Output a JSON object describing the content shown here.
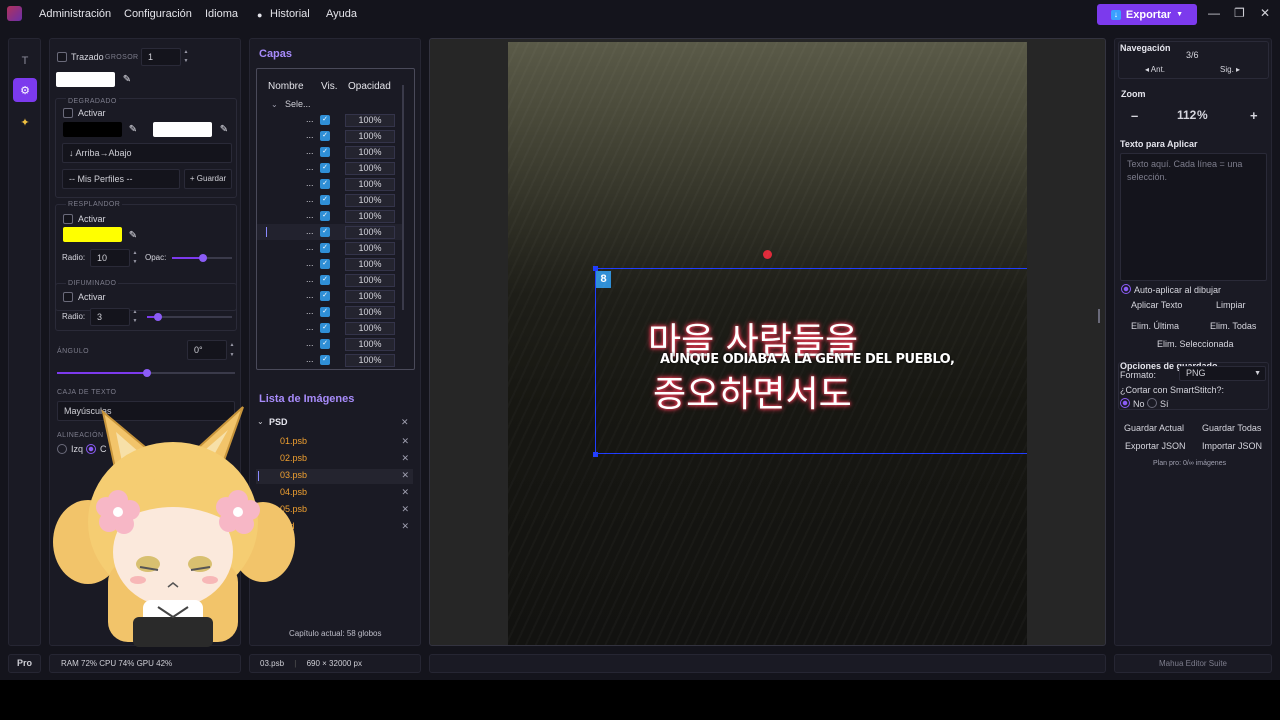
{
  "menu": {
    "items": [
      "Administración",
      "Configuración",
      "Idioma",
      "Historial",
      "Ayuda"
    ],
    "export_label": "Exportar"
  },
  "props": {
    "stroke_label": "Trazado",
    "thickness_label": "GROSOR",
    "thickness_value": "1",
    "gradient_label": "Degradado",
    "gradient_activate": "Activar",
    "gradient_direction": "↓ Arriba→Abajo",
    "profiles": "-- Mis Perfiles --",
    "save_label": "+ Guardar",
    "glow_label": "Resplandor",
    "glow_activate": "Activar",
    "glow_color": "#ffff00",
    "radius_label": "Radio:",
    "glow_radius": "10",
    "opac_label": "Opac:",
    "blur_label": "Difuminado",
    "blur_activate": "Activar",
    "blur_radius_label": "Radio:",
    "blur_radius": "3",
    "angle_label": "ÁNGULO",
    "angle_value": "0°",
    "textbox_label": "CAJA DE TEXTO",
    "textbox_value": "Mayúsculas",
    "align_label": "ALINEACIÓN",
    "align_left": "Izq",
    "align_center": "C"
  },
  "layers": {
    "title": "Capas",
    "col_name": "Nombre",
    "col_vis": "Vis.",
    "col_opacity": "Opacidad",
    "group_name": "Sele...",
    "rows": [
      {
        "name": "...",
        "opacity": "100%"
      },
      {
        "name": "...",
        "opacity": "100%"
      },
      {
        "name": "...",
        "opacity": "100%"
      },
      {
        "name": "...",
        "opacity": "100%"
      },
      {
        "name": "...",
        "opacity": "100%"
      },
      {
        "name": "...",
        "opacity": "100%"
      },
      {
        "name": "...",
        "opacity": "100%"
      },
      {
        "name": "...",
        "opacity": "100%"
      },
      {
        "name": "...",
        "opacity": "100%"
      },
      {
        "name": "...",
        "opacity": "100%"
      },
      {
        "name": "...",
        "opacity": "100%"
      },
      {
        "name": "...",
        "opacity": "100%"
      },
      {
        "name": "...",
        "opacity": "100%"
      },
      {
        "name": "...",
        "opacity": "100%"
      },
      {
        "name": "...",
        "opacity": "100%"
      },
      {
        "name": "...",
        "opacity": "100%"
      }
    ]
  },
  "images": {
    "title": "Lista de Imágenes",
    "group": "PSD",
    "files": [
      "01.psb",
      "02.psb",
      "03.psb",
      "04.psb",
      "05.psb",
      "psd"
    ],
    "chapter_info": "Capítulo actual: 58 globos"
  },
  "canvas": {
    "badge": "8",
    "korean_line1": "마을 사람들을",
    "korean_line2": "증오하면서도",
    "spanish_text": "AUNQUE ODIABA A LA GENTE DEL PUEBLO,"
  },
  "right": {
    "nav_title": "Navegación",
    "nav_page": "3/6",
    "nav_prev": "◂ Ant.",
    "nav_next": "Sig. ▸",
    "zoom_title": "Zoom",
    "zoom_minus": "–",
    "zoom_value": "112",
    "zoom_unit": "%",
    "zoom_plus": "+",
    "text_title": "Texto para Aplicar",
    "text_placeholder": "Texto aquí. Cada línea = una selección.",
    "auto_apply": "Auto-aplicar al dibujar",
    "apply_text": "Aplicar Texto",
    "clear": "Limpiar",
    "del_last": "Elim. Última",
    "del_all": "Elim. Todas",
    "del_selected": "Elim. Seleccionada",
    "save_options": "Opciones de guardado",
    "format_label": "Formato:",
    "format_value": "PNG",
    "smartstitch": "¿Cortar con SmartStitch?:",
    "opt_no": "No",
    "opt_si": "Sí",
    "save_current": "Guardar Actual",
    "save_all": "Guardar Todas",
    "export_json": "Exportar JSON",
    "import_json": "Importar JSON",
    "plan": "Plan pro: 0/∞ imágenes"
  },
  "status": {
    "pro": "Pro",
    "resources": "RAM 72%   CPU 74%   GPU 42%",
    "file": "03.psb",
    "dimensions": "690 × 32000 px",
    "suite": "Mahua Editor Suite"
  }
}
